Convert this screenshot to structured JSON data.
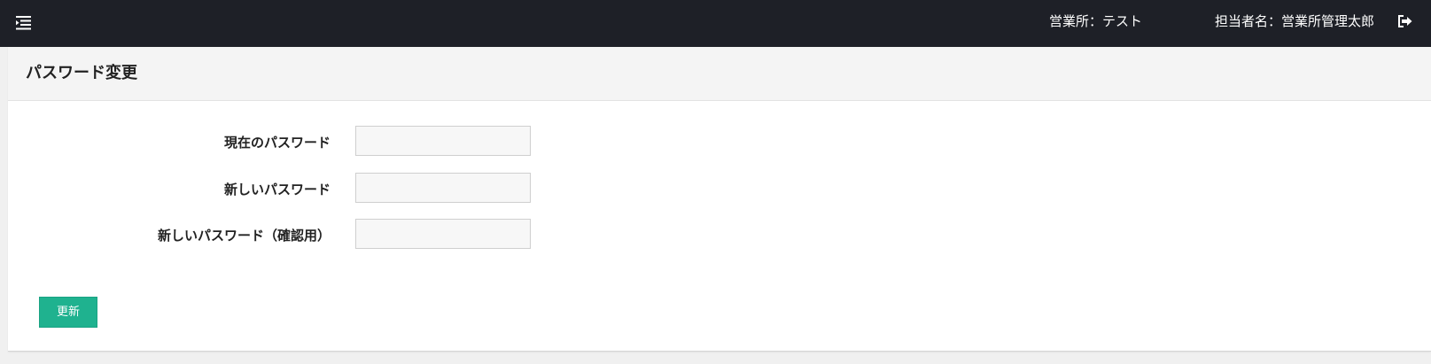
{
  "header": {
    "office_label": "営業所：テスト",
    "staff_label": "担当者名：営業所管理太郎",
    "icons": {
      "menu": "menu-toggle-icon",
      "logout": "sign-out-icon"
    }
  },
  "page": {
    "title": "パスワード変更"
  },
  "form": {
    "fields": [
      {
        "label": "現在のパスワード",
        "value": "",
        "placeholder": ""
      },
      {
        "label": "新しいパスワード",
        "value": "",
        "placeholder": ""
      },
      {
        "label": "新しいパスワード（確認用）",
        "value": "",
        "placeholder": ""
      }
    ],
    "submit_label": "更新"
  },
  "colors": {
    "topbar_bg": "#1e2027",
    "button_bg": "#1fb28f",
    "panel_header_bg": "#f4f4f4",
    "page_bg": "#f0f0f0"
  }
}
